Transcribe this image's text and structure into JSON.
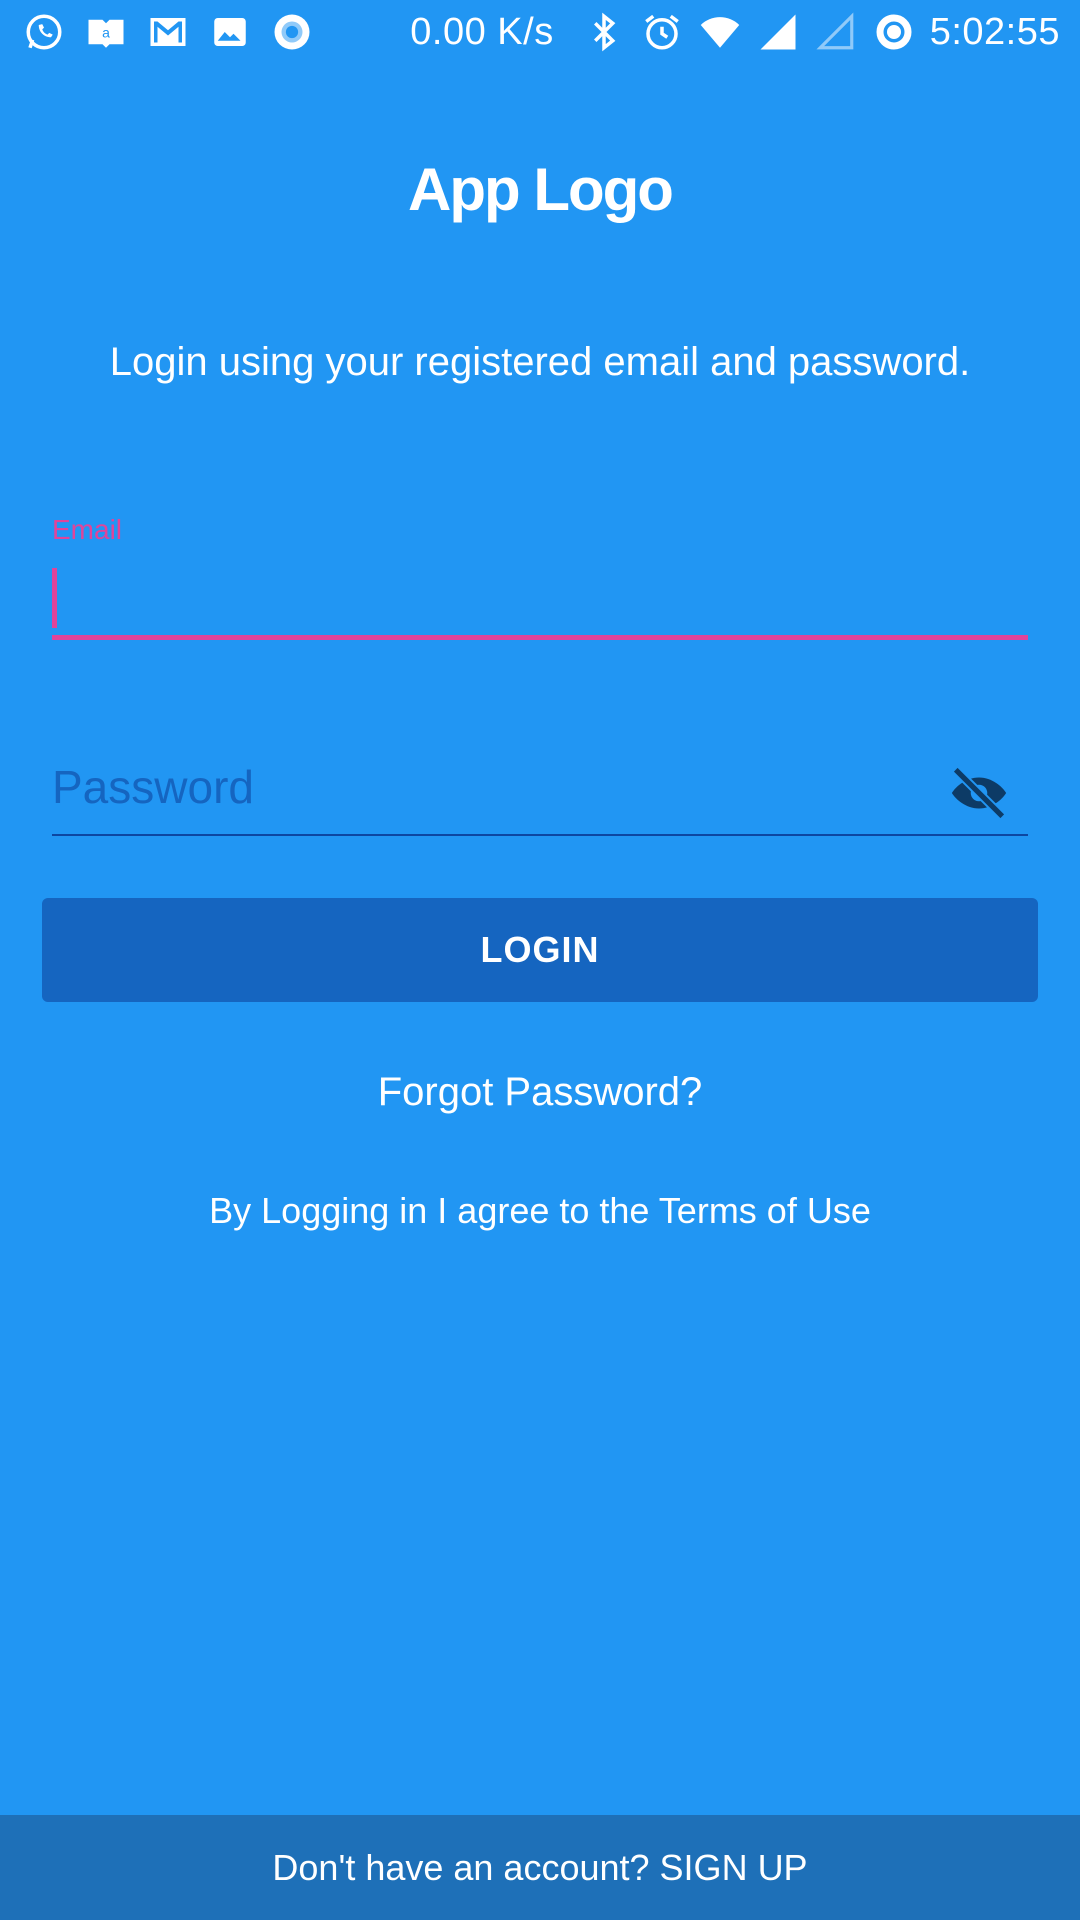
{
  "status_bar": {
    "net_speed": "0.00 K/s",
    "time": "5:02:55",
    "left_icons": [
      "whatsapp-icon",
      "amazon-kindle-icon",
      "gmail-icon",
      "gallery-icon",
      "record-icon"
    ],
    "right_icons": [
      "bluetooth-icon",
      "alarm-icon",
      "wifi-icon",
      "signal-icon",
      "signal-empty-icon",
      "data-saver-icon"
    ]
  },
  "logo": {
    "text": "App Logo"
  },
  "subtitle": "Login using your registered email and password.",
  "email": {
    "label": "Email",
    "value": ""
  },
  "password": {
    "placeholder": "Password",
    "toggle_icon": "visibility-off-icon"
  },
  "login_button": {
    "label": "LOGIN"
  },
  "forgot_link": "Forgot Password?",
  "terms_text": "By Logging in I agree to the Terms of Use",
  "signup_bar": "Don't have an account? SIGN UP",
  "colors": {
    "background": "#2196F3",
    "focus_accent": "#E0449A",
    "button": "#1565C0",
    "bottom_bar": "#1E70B8"
  }
}
